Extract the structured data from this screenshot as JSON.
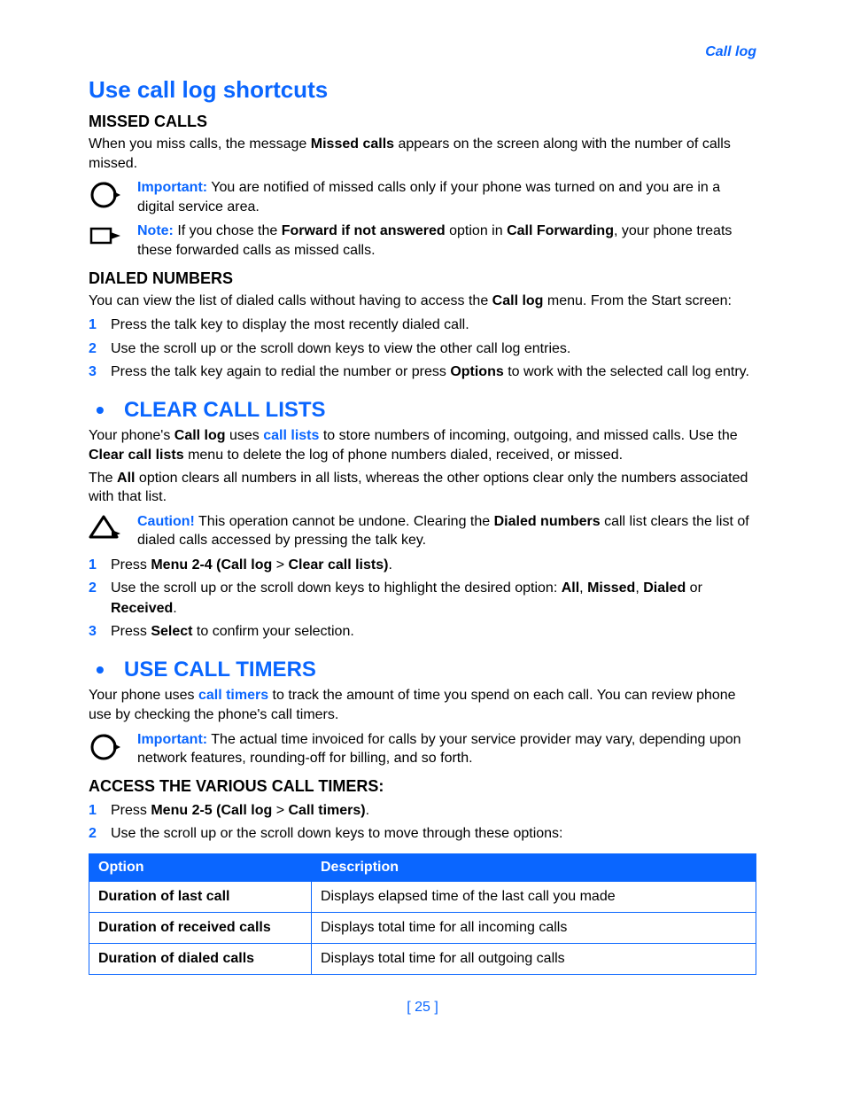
{
  "header": {
    "label": "Call log"
  },
  "s1": {
    "title": "Use call log shortcuts",
    "missed": {
      "heading": "MISSED CALLS",
      "p1a": "When you miss calls, the message ",
      "p1b": "Missed calls",
      "p1c": " appears on the screen along with the number of calls missed.",
      "impLabel": "Important:",
      "imp": " You are notified of missed calls only if your phone was turned on and you are in a digital service area.",
      "noteLabel": "Note:",
      "noteA": " If you chose the ",
      "noteB": "Forward if not answered",
      "noteC": " option in ",
      "noteD": "Call Forwarding",
      "noteE": ", your phone treats these forwarded calls as missed calls."
    },
    "dialed": {
      "heading": "DIALED NUMBERS",
      "p1a": "You can view the list of dialed calls without having to access the ",
      "p1b": "Call log",
      "p1c": " menu. From the Start screen:",
      "li1": "Press the talk key to display the most recently dialed call.",
      "li2": "Use the scroll up or the scroll down keys to view the other call log entries.",
      "li3a": "Press the talk key again to redial the number or press ",
      "li3b": "Options",
      "li3c": " to work with the selected call log entry."
    }
  },
  "s2": {
    "title": "CLEAR CALL LISTS",
    "p1a": "Your phone's ",
    "p1b": "Call log",
    "p1c": " uses ",
    "p1d": "call lists",
    "p1e": " to store numbers of incoming, outgoing, and missed calls. Use the ",
    "p1f": "Clear call lists",
    "p1g": " menu to delete the log of phone numbers dialed, received, or missed.",
    "p2a": "The ",
    "p2b": "All",
    "p2c": " option clears all numbers in all lists, whereas the other options clear only the numbers associated with that list.",
    "cautionLabel": "Caution!",
    "cautionA": " This operation cannot be undone. Clearing the ",
    "cautionB": "Dialed numbers",
    "cautionC": " call list clears the list of dialed calls accessed by pressing the talk key.",
    "li1a": "Press ",
    "li1b": "Menu 2-4 (Call log",
    "li1c": " > ",
    "li1d": "Clear call lists)",
    "li1e": ".",
    "li2a": "Use the scroll up or the scroll down keys to highlight the desired option: ",
    "li2b": "All",
    "li2c": ", ",
    "li2d": "Missed",
    "li2e": ", ",
    "li2f": "Dialed",
    "li2g": " or ",
    "li2h": "Received",
    "li2i": ".",
    "li3a": "Press ",
    "li3b": "Select",
    "li3c": " to confirm your selection."
  },
  "s3": {
    "title": "USE CALL TIMERS",
    "p1a": "Your phone uses ",
    "p1b": "call timers",
    "p1c": " to track the amount of time you spend on each call. You can review phone use by checking the phone's call timers.",
    "impLabel": "Important:",
    "imp": " The actual time invoiced for calls by your service provider may vary, depending upon network features, rounding-off for billing, and so forth.",
    "accessHeading": "ACCESS THE VARIOUS CALL TIMERS:",
    "li1a": "Press ",
    "li1b": "Menu 2-5 (Call log",
    "li1c": " > ",
    "li1d": "Call timers)",
    "li1e": ".",
    "li2": "Use the scroll up or the scroll down keys to move through these options:",
    "table": {
      "h1": "Option",
      "h2": "Description",
      "rows": [
        {
          "opt": "Duration of last call",
          "desc": "Displays elapsed time of the last call you made"
        },
        {
          "opt": "Duration of received calls",
          "desc": "Displays total time for all incoming calls"
        },
        {
          "opt": "Duration of dialed calls",
          "desc": "Displays total time for all outgoing calls"
        }
      ]
    }
  },
  "footer": {
    "page": "[ 25 ]"
  }
}
